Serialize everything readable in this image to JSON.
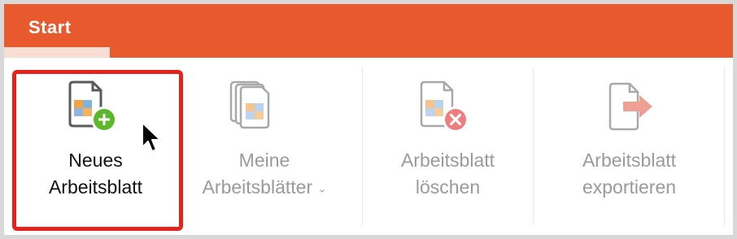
{
  "tab": {
    "label": "Start"
  },
  "tools": [
    {
      "line1": "Neues",
      "line2": "Arbeitsblatt"
    },
    {
      "line1": "Meine",
      "line2": "Arbeitsblätter",
      "dropdown_glyph": "⌄"
    },
    {
      "line1": "Arbeitsblatt",
      "line2": "löschen"
    },
    {
      "line1": "Arbeitsblatt",
      "line2": "exportieren"
    }
  ],
  "icons": {
    "new": "worksheet-add-icon",
    "mine": "worksheet-stack-icon",
    "delete": "worksheet-delete-icon",
    "export": "worksheet-export-icon"
  },
  "colors": {
    "ribbon": "#e85a2e",
    "highlight": "#e5231b",
    "add_green": "#5cb82a",
    "delete_red": "#ef7e7e",
    "export_arrow": "#f0a093"
  }
}
